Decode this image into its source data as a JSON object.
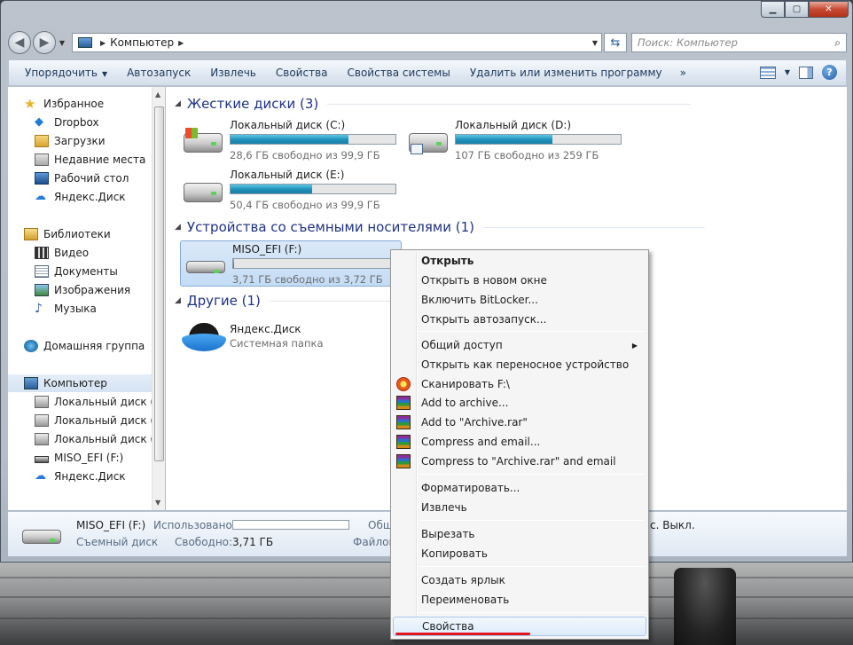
{
  "window": {
    "caption": {
      "minimize": "▁",
      "maximize": "▢",
      "close": "✕"
    }
  },
  "nav": {
    "address": "Компьютер",
    "search_placeholder": "Поиск: Компьютер"
  },
  "toolbar": {
    "items": [
      "Упорядочить",
      "Автозапуск",
      "Извлечь",
      "Свойства",
      "Свойства системы",
      "Удалить или изменить программу"
    ],
    "more": "»"
  },
  "sidebar": {
    "favorites": [
      "Избранное",
      "Dropbox",
      "Загрузки",
      "Недавние места",
      "Рабочий стол",
      "Яндекс.Диск"
    ],
    "libraries": [
      "Библиотеки",
      "Видео",
      "Документы",
      "Изображения",
      "Музыка"
    ],
    "homegroup": "Домашняя группа",
    "computer": [
      "Компьютер",
      "Локальный диск (C:",
      "Локальный диск (D:",
      "Локальный диск (E:",
      "MISO_EFI (F:)",
      "Яндекс.Диск"
    ]
  },
  "content": {
    "groups": {
      "hdd": "Жесткие диски (3)",
      "removable": "Устройства со съемными носителями (1)",
      "other": "Другие (1)"
    },
    "drives": [
      {
        "name": "Локальный диск (C:)",
        "free": "28,6 ГБ свободно из 99,9 ГБ",
        "used_fraction": 0.714
      },
      {
        "name": "Локальный диск (D:)",
        "free": "107 ГБ свободно из 259 ГБ",
        "used_fraction": 0.587
      },
      {
        "name": "Локальный диск (E:)",
        "free": "50,4 ГБ свободно из 99,9 ГБ",
        "used_fraction": 0.495
      },
      {
        "name": "MISO_EFI (F:)",
        "free": "3,71 ГБ свободно из 3,72 ГБ",
        "used_fraction": 0.003
      }
    ],
    "other_item": {
      "name": "Яндекс.Диск",
      "desc": "Системная папка"
    }
  },
  "details": {
    "name": "MISO_EFI (F:)",
    "type": "Съемный диск",
    "used_label": "Использовано:",
    "free_label": "Свободно:",
    "free_value": "3,71 ГБ",
    "col3_label_a": "Общ",
    "col3_label_b": "Файлов",
    "col4_value": "с. Выкл."
  },
  "context_menu": {
    "items": [
      "Открыть",
      "Открыть в новом окне",
      "Включить BitLocker...",
      "Открыть автозапуск...",
      "Общий доступ",
      "Открыть как переносное устройство",
      "Сканировать F:\\",
      "Add to archive...",
      "Add to \"Archive.rar\"",
      "Compress and email...",
      "Compress to \"Archive.rar\" and email",
      "Форматировать...",
      "Извлечь",
      "Вырезать",
      "Копировать",
      "Создать ярлык",
      "Переименовать",
      "Свойства"
    ]
  },
  "colors": {
    "accent_bar": "#1f8fb8",
    "group_header": "#1e3287",
    "underline": "#e3141e"
  }
}
